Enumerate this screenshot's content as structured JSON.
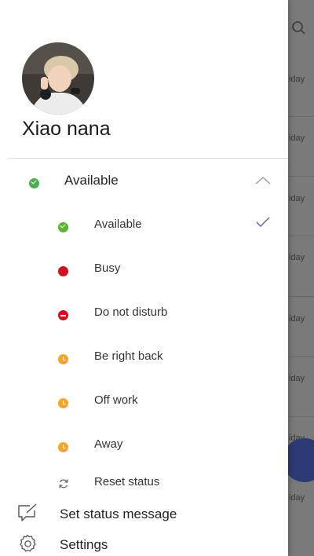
{
  "user": {
    "name": "Xiao nana"
  },
  "current_status": {
    "label": "Available",
    "color": "#4caf50"
  },
  "status_options": [
    {
      "label": "Available",
      "color": "#5cb531",
      "icon": "check-icon",
      "selected": true
    },
    {
      "label": "Busy",
      "color": "#d0111b",
      "icon": "busy-dot"
    },
    {
      "label": "Do not disturb",
      "color": "#d0111b",
      "icon": "minus-icon"
    },
    {
      "label": "Be right back",
      "color": "#f5a623",
      "icon": "clock-icon"
    },
    {
      "label": "Off work",
      "color": "#f5a623",
      "icon": "clock-icon"
    },
    {
      "label": "Away",
      "color": "#f5a623",
      "icon": "clock-icon"
    }
  ],
  "reset_status": {
    "label": "Reset status"
  },
  "menu": {
    "set_status_message": "Set status message",
    "settings": "Settings"
  },
  "background": {
    "day_labels": [
      "iday",
      "iday",
      "iday",
      "iday",
      "iday",
      "iday",
      "iday",
      "iday"
    ]
  }
}
